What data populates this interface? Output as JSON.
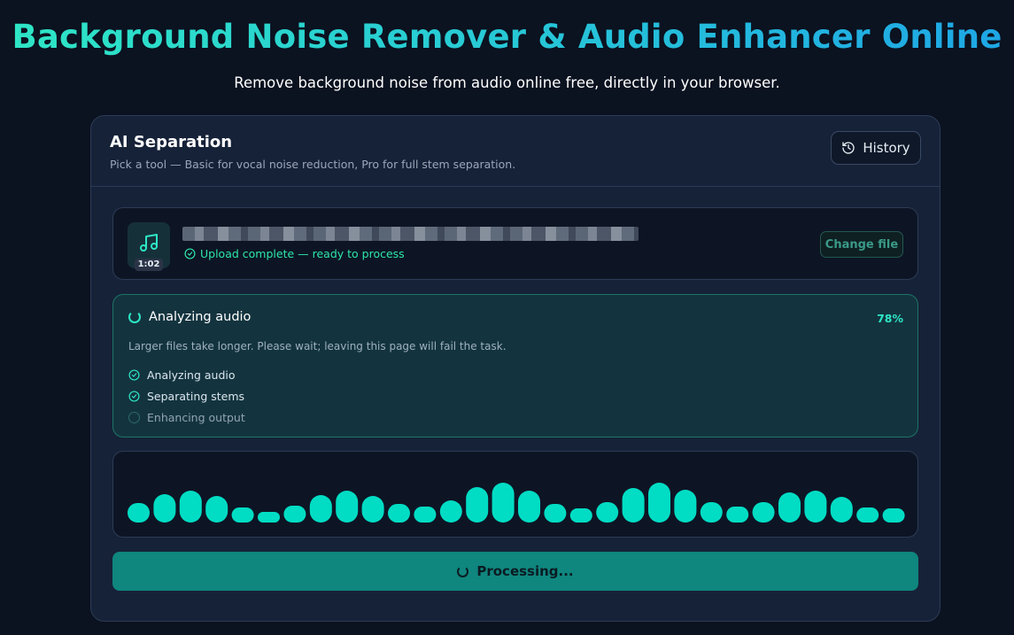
{
  "hero": {
    "title": "Background Noise Remover & Audio Enhancer Online",
    "subtitle": "Remove background noise from audio online free, directly in your browser."
  },
  "card": {
    "title": "AI Separation",
    "description": "Pick a tool — Basic for vocal noise reduction, Pro for full stem separation.",
    "history_label": "History"
  },
  "file": {
    "duration": "1:02",
    "status": "Upload complete — ready to process",
    "change_label": "Change file"
  },
  "progress": {
    "title": "Analyzing audio",
    "percent_label": "78%",
    "percent": 78,
    "note": "Larger files take longer. Please wait; leaving this page will fail the task.",
    "steps": [
      {
        "label": "Analyzing audio",
        "done": true
      },
      {
        "label": "Separating stems",
        "done": true
      },
      {
        "label": "Enhancing output",
        "done": false
      }
    ]
  },
  "waveform": {
    "color": "#00ddc4",
    "levels": [
      22,
      32,
      36,
      30,
      17,
      12,
      19,
      31,
      36,
      30,
      21,
      18,
      25,
      40,
      45,
      36,
      21,
      16,
      23,
      39,
      45,
      37,
      23,
      18,
      23,
      34,
      36,
      29,
      17,
      16
    ]
  },
  "process_button": {
    "label": "Processing..."
  },
  "colors": {
    "accent": "#2ee6c5",
    "background": "#0b1220",
    "card": "#162238",
    "button": "#0f867e"
  }
}
